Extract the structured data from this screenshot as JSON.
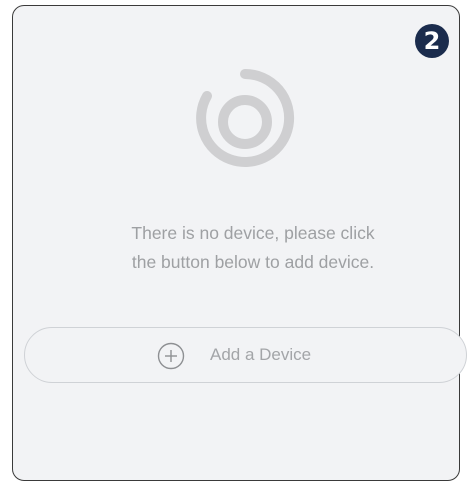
{
  "badge": {
    "step": "2"
  },
  "empty_state": {
    "icon": "device-ring-icon",
    "line1": "There is no device, please click",
    "line2": "the button below to add device."
  },
  "add_button": {
    "label": "Add a Device",
    "icon": "plus-circle-icon"
  },
  "colors": {
    "card_background": "#f2f3f5",
    "border": "#3a3a3a",
    "muted_text": "#9ea0a3",
    "icon_gray": "#cfcfd1",
    "badge": "#1b2c4d"
  }
}
